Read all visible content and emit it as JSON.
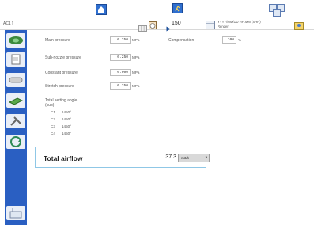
{
  "header": {
    "screen_id": "AC1 ]",
    "speed_value": "150",
    "datetime_line1": "YYYY/MM/DD HH:MM (SHR)",
    "datetime_line2": "Render"
  },
  "sidebar": {
    "items": [
      {
        "icon": "airflow-fan-icon"
      },
      {
        "icon": "document-icon"
      },
      {
        "icon": "pipe-icon"
      },
      {
        "icon": "nozzle-icon"
      },
      {
        "icon": "wrench-tools-icon"
      },
      {
        "icon": "cycle-arrow-icon"
      },
      {
        "icon": "loom-machine-icon"
      }
    ]
  },
  "settings": {
    "main_pressure": {
      "label": "Main pressure",
      "value": "0.250",
      "unit": "MPa"
    },
    "sub_nozzle_pressure": {
      "label": "Sub-nozzle pressure",
      "value": "0.250",
      "unit": "MPa"
    },
    "constant_pressure": {
      "label": "Constant pressure",
      "value": "0.000",
      "unit": "MPa"
    },
    "stretch_pressure": {
      "label": "Stretch pressure",
      "value": "0.250",
      "unit": "MPa"
    },
    "compensation": {
      "label": "Compensation",
      "value": "100",
      "unit": "%"
    }
  },
  "setting_angle": {
    "title_line1": "Total setting angle",
    "title_line2": "(sub)",
    "rows": [
      {
        "label": "C1",
        "value": "1450°"
      },
      {
        "label": "C2",
        "value": "1450°"
      },
      {
        "label": "C3",
        "value": "1450°"
      },
      {
        "label": "C4",
        "value": "1450°"
      }
    ]
  },
  "airflow": {
    "title": "Total airflow",
    "value": "37.3",
    "unit": "m3/h"
  }
}
